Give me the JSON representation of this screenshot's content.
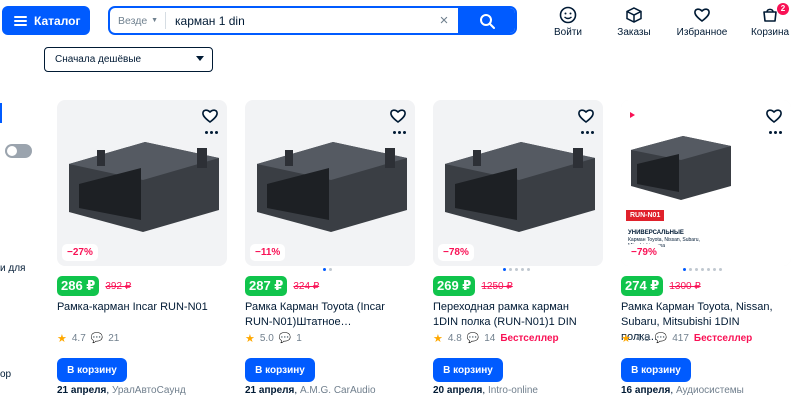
{
  "header": {
    "catalog_label": "Каталог",
    "search_scope": "Везде",
    "search_query": "карман 1 din",
    "nav": [
      {
        "label": "Войти",
        "icon": "smile-icon"
      },
      {
        "label": "Заказы",
        "icon": "box-icon"
      },
      {
        "label": "Избранное",
        "icon": "heart-icon"
      },
      {
        "label": "Корзина",
        "icon": "cart-icon",
        "badge": "2"
      }
    ]
  },
  "sort": {
    "selected": "Сначала дешёвые"
  },
  "sidebar": {
    "text_1": "и для",
    "text_2": "ор"
  },
  "products": [
    {
      "discount": "−27%",
      "price": "286 ₽",
      "old_price": "392 ₽",
      "title": "Рамка-карман Incar RUN-N01",
      "rating": "4.7",
      "reviews": "21",
      "bestseller": "",
      "cart_label": "В корзину",
      "delivery_date": "21 апреля",
      "seller": "УралАвтоСаунд"
    },
    {
      "discount": "−11%",
      "price": "287 ₽",
      "old_price": "324 ₽",
      "title": "Рамка Карман Toyota (Incar RUN-N01)Штатное…",
      "rating": "5.0",
      "reviews": "1",
      "bestseller": "",
      "cart_label": "В корзину",
      "delivery_date": "21 апреля",
      "seller": "A.M.G. CarAudio"
    },
    {
      "discount": "−78%",
      "price": "269 ₽",
      "old_price": "1250 ₽",
      "title": "Переходная рамка карман 1DIN полка (RUN-N01)1 DIN",
      "rating": "4.8",
      "reviews": "14",
      "bestseller": "Бестселлер",
      "cart_label": "В корзину",
      "delivery_date": "20 апреля",
      "seller": "Intro-online"
    },
    {
      "discount": "−79%",
      "price": "274 ₽",
      "old_price": "1300 ₽",
      "title": "Рамка Карман Toyota, Nissan, Subaru, Mitsubishi 1DIN полка…",
      "rating": "4.8",
      "reviews": "417",
      "bestseller": "Бестселлер",
      "cart_label": "В корзину",
      "delivery_date": "16 апреля",
      "seller": "Аудиосистемы",
      "image_label": "RUN-N01",
      "image_heading": "УНИВЕРСАЛЬНЫЕ",
      "image_sub": "Карман Toyota, Nissan, Subaru, Mitsubishi полка"
    }
  ],
  "colors": {
    "accent": "#005bff",
    "price": "#10c44c",
    "sale": "#f91155",
    "rating": "#ffa800"
  }
}
